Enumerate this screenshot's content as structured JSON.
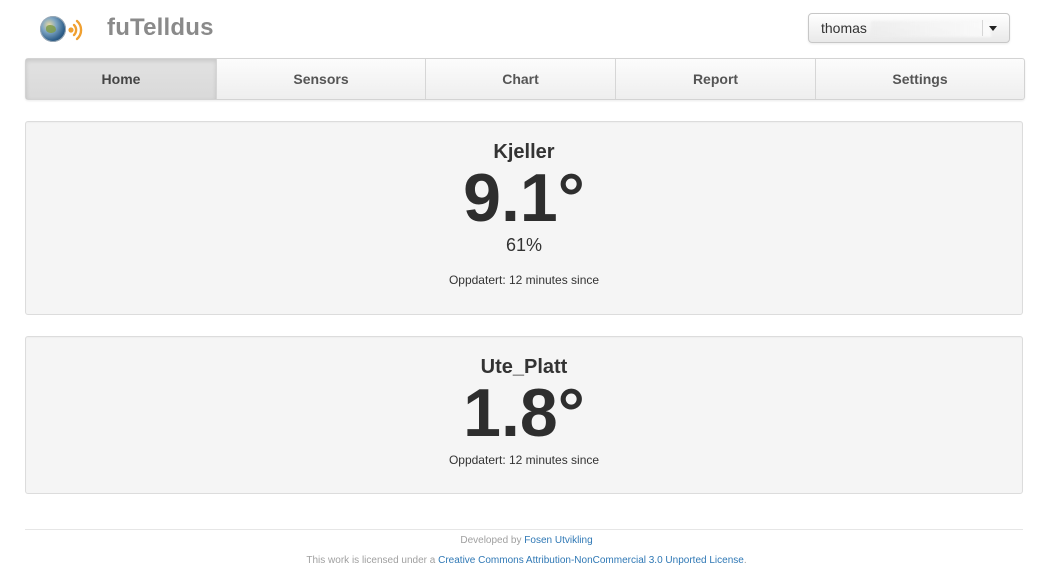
{
  "header": {
    "brand": "fuTelldus",
    "user": {
      "name": "thomas"
    }
  },
  "nav": {
    "tabs": [
      {
        "label": "Home",
        "active": true
      },
      {
        "label": "Sensors",
        "active": false
      },
      {
        "label": "Chart",
        "active": false
      },
      {
        "label": "Report",
        "active": false
      },
      {
        "label": "Settings",
        "active": false
      }
    ]
  },
  "sensors": [
    {
      "name": "Kjeller",
      "temperature": "9.1°",
      "humidity": "61%",
      "updated": "Oppdatert: 12 minutes since"
    },
    {
      "name": "Ute_Platt",
      "temperature": "1.8°",
      "updated": "Oppdatert: 12 minutes since"
    }
  ],
  "footer": {
    "developed_prefix": "Developed by ",
    "developer": "Fosen Utvikling",
    "license_prefix": "This work is licensed under a ",
    "license": "Creative Commons Attribution-NonCommercial 3.0 Unported License",
    "license_suffix": "."
  },
  "colors": {
    "brand_text": "#8a8a8a",
    "link": "#2f78b5",
    "card_bg": "#f5f5f5",
    "rss_orange": "#f0a030"
  },
  "icons": {
    "logo": "globe-icon",
    "logo_waves": "rss-waves-icon",
    "dropdown": "caret-down-icon"
  }
}
